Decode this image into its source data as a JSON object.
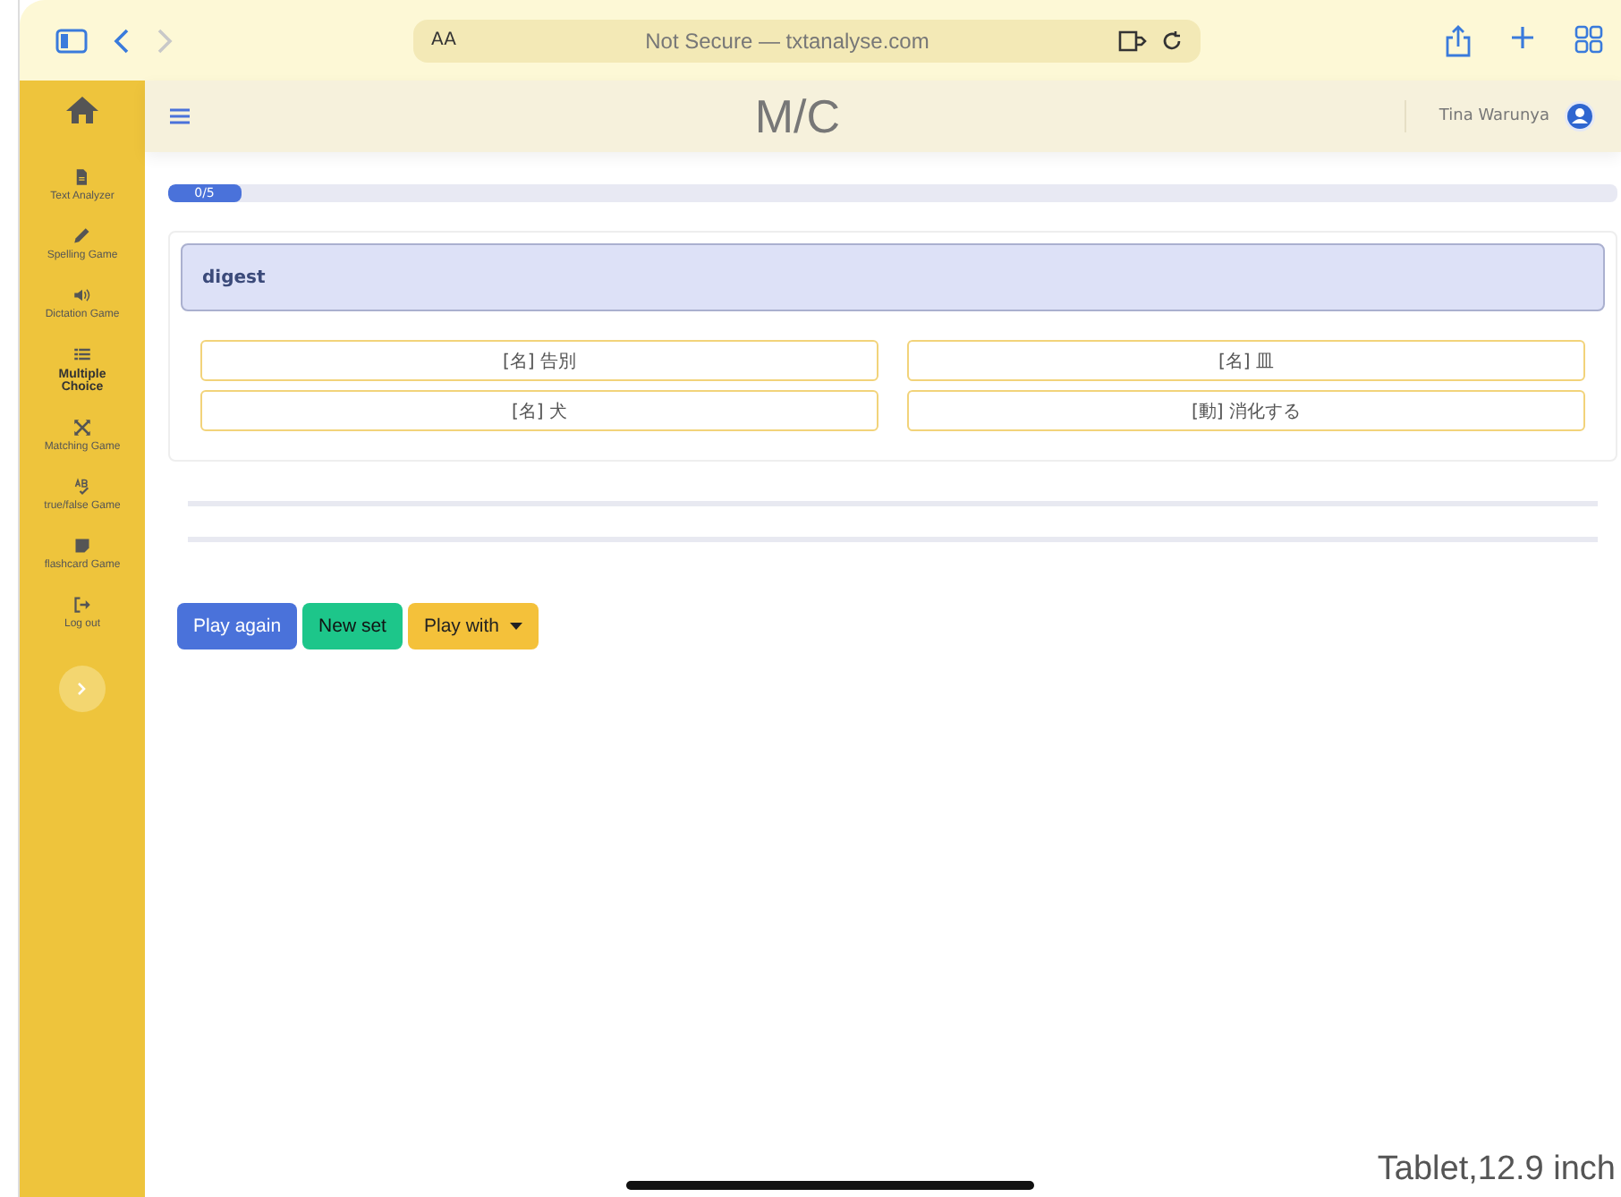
{
  "browser": {
    "text_size": "AA",
    "address": "Not Secure — txtanalyse.com"
  },
  "sidebar": {
    "items": [
      {
        "kind": "doc",
        "label": "Text Analyzer",
        "selected": false
      },
      {
        "kind": "pencil",
        "label": "Spelling Game",
        "selected": false
      },
      {
        "kind": "speaker",
        "label": "Dictation Game",
        "selected": false
      },
      {
        "kind": "list",
        "label": "Multiple Choice",
        "selected": true
      },
      {
        "kind": "cross",
        "label": "Matching Game",
        "selected": false
      },
      {
        "kind": "ab",
        "label": "true/false Game",
        "selected": false
      },
      {
        "kind": "note",
        "label": "flashcard Game",
        "selected": false
      },
      {
        "kind": "logout",
        "label": "Log out",
        "selected": false
      }
    ]
  },
  "header": {
    "title": "M/C",
    "user": "Tina Warunya"
  },
  "progress": {
    "label": "0/5",
    "level": 0.05
  },
  "question": {
    "word": "digest",
    "options": [
      {
        "label": "[名] 告別"
      },
      {
        "label": "[名] 皿"
      },
      {
        "label": "[名] 犬"
      },
      {
        "label": "[動] 消化する"
      }
    ]
  },
  "buttons": [
    {
      "label": "Play again",
      "kind": "primary"
    },
    {
      "label": "New set",
      "kind": "success"
    },
    {
      "label": "Play with",
      "kind": "dropdown"
    }
  ],
  "caption": "Tablet,12.9 inch"
}
